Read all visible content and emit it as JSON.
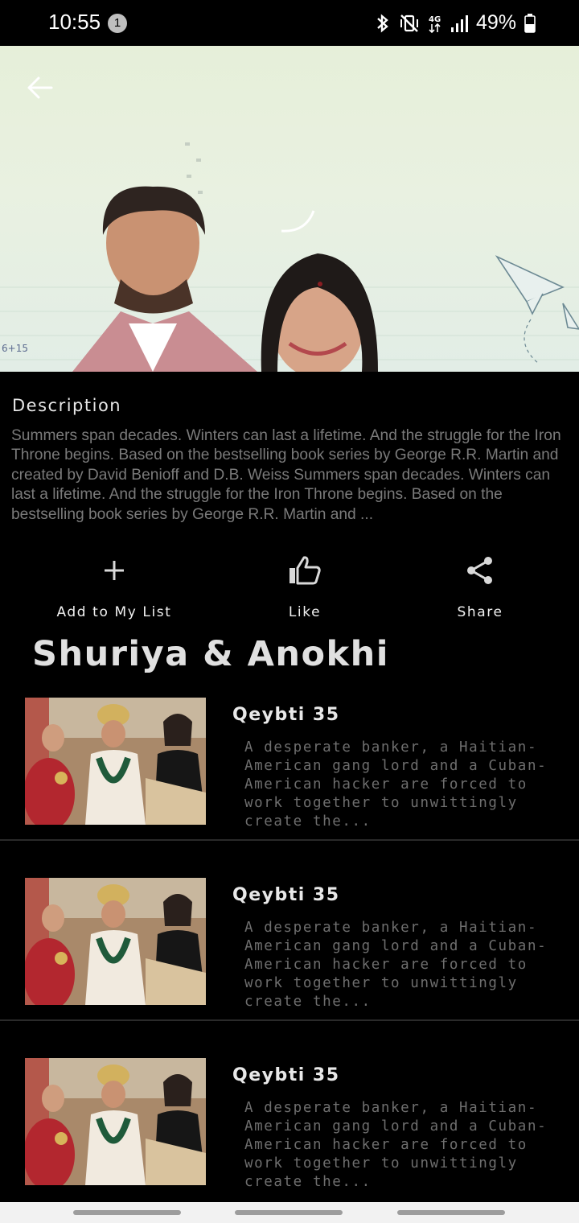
{
  "status_bar": {
    "time": "10:55",
    "notification_count": "1",
    "battery": "49%",
    "icons": [
      "bluetooth-icon",
      "vibrate-off-icon",
      "4g-icon",
      "signal-icon",
      "battery-icon"
    ]
  },
  "header": {
    "back_icon": "back-arrow-icon"
  },
  "description": {
    "title": "Description",
    "body": "Summers span decades. Winters can last a lifetime. And the struggle for the Iron Throne begins. Based on the bestselling book series by George R.R. Martin and created by David Benioff and D.B. Weiss Summers span decades. Winters can last a lifetime. And the struggle for the Iron Throne begins. Based on the bestselling book series by George R.R. Martin and ..."
  },
  "actions": {
    "add": {
      "label": "Add to My List",
      "icon": "plus-icon"
    },
    "like": {
      "label": "Like",
      "icon": "thumbs-up-icon"
    },
    "share": {
      "label": "Share",
      "icon": "share-icon"
    }
  },
  "show": {
    "title": "Shuriya & Anokhi"
  },
  "episodes": [
    {
      "title": "Qeybti 35",
      "description": "A desperate banker, a Haitian-American gang lord and a Cuban-American hacker are forced to work together to unwittingly create the..."
    },
    {
      "title": "Qeybti 35",
      "description": "A desperate banker, a Haitian-American gang lord and a Cuban-American hacker are forced to work together to unwittingly create the..."
    },
    {
      "title": "Qeybti 35",
      "description": "A desperate banker, a Haitian-American gang lord and a Cuban-American hacker are forced to work together to unwittingly create the..."
    }
  ],
  "colors": {
    "background": "#000000",
    "text_primary": "#e8e8e8",
    "text_muted": "#7a7a7a"
  }
}
